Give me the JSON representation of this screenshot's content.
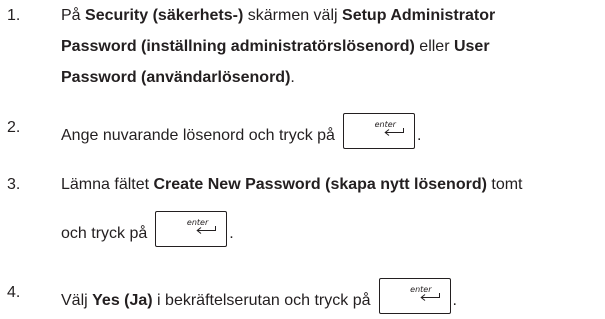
{
  "steps": [
    {
      "number": "1.",
      "lines": [
        [
          "På ",
          "Security (säkerhets-)",
          " skärmen välj ",
          "Setup Administrator"
        ],
        [
          "Password (inställning administratörslösenord)",
          " eller ",
          "User"
        ],
        [
          "Password (användarlösenord)",
          "."
        ]
      ]
    },
    {
      "number": "2.",
      "text": "Ange nuvarande lösenord och tryck på",
      "after_key": "."
    },
    {
      "number": "3.",
      "text_a": "Lämna fältet ",
      "bold": "Create New Password (skapa nytt lösenord)",
      "text_b": " tomt",
      "line2": "och tryck på",
      "after_key": "."
    },
    {
      "number": "4.",
      "text_a": "Välj ",
      "bold": "Yes (Ja)",
      "text_b": " i bekräftelserutan och tryck på",
      "after_key": "."
    }
  ],
  "enter_key": {
    "label": "enter",
    "icon": "return-arrow-icon"
  }
}
